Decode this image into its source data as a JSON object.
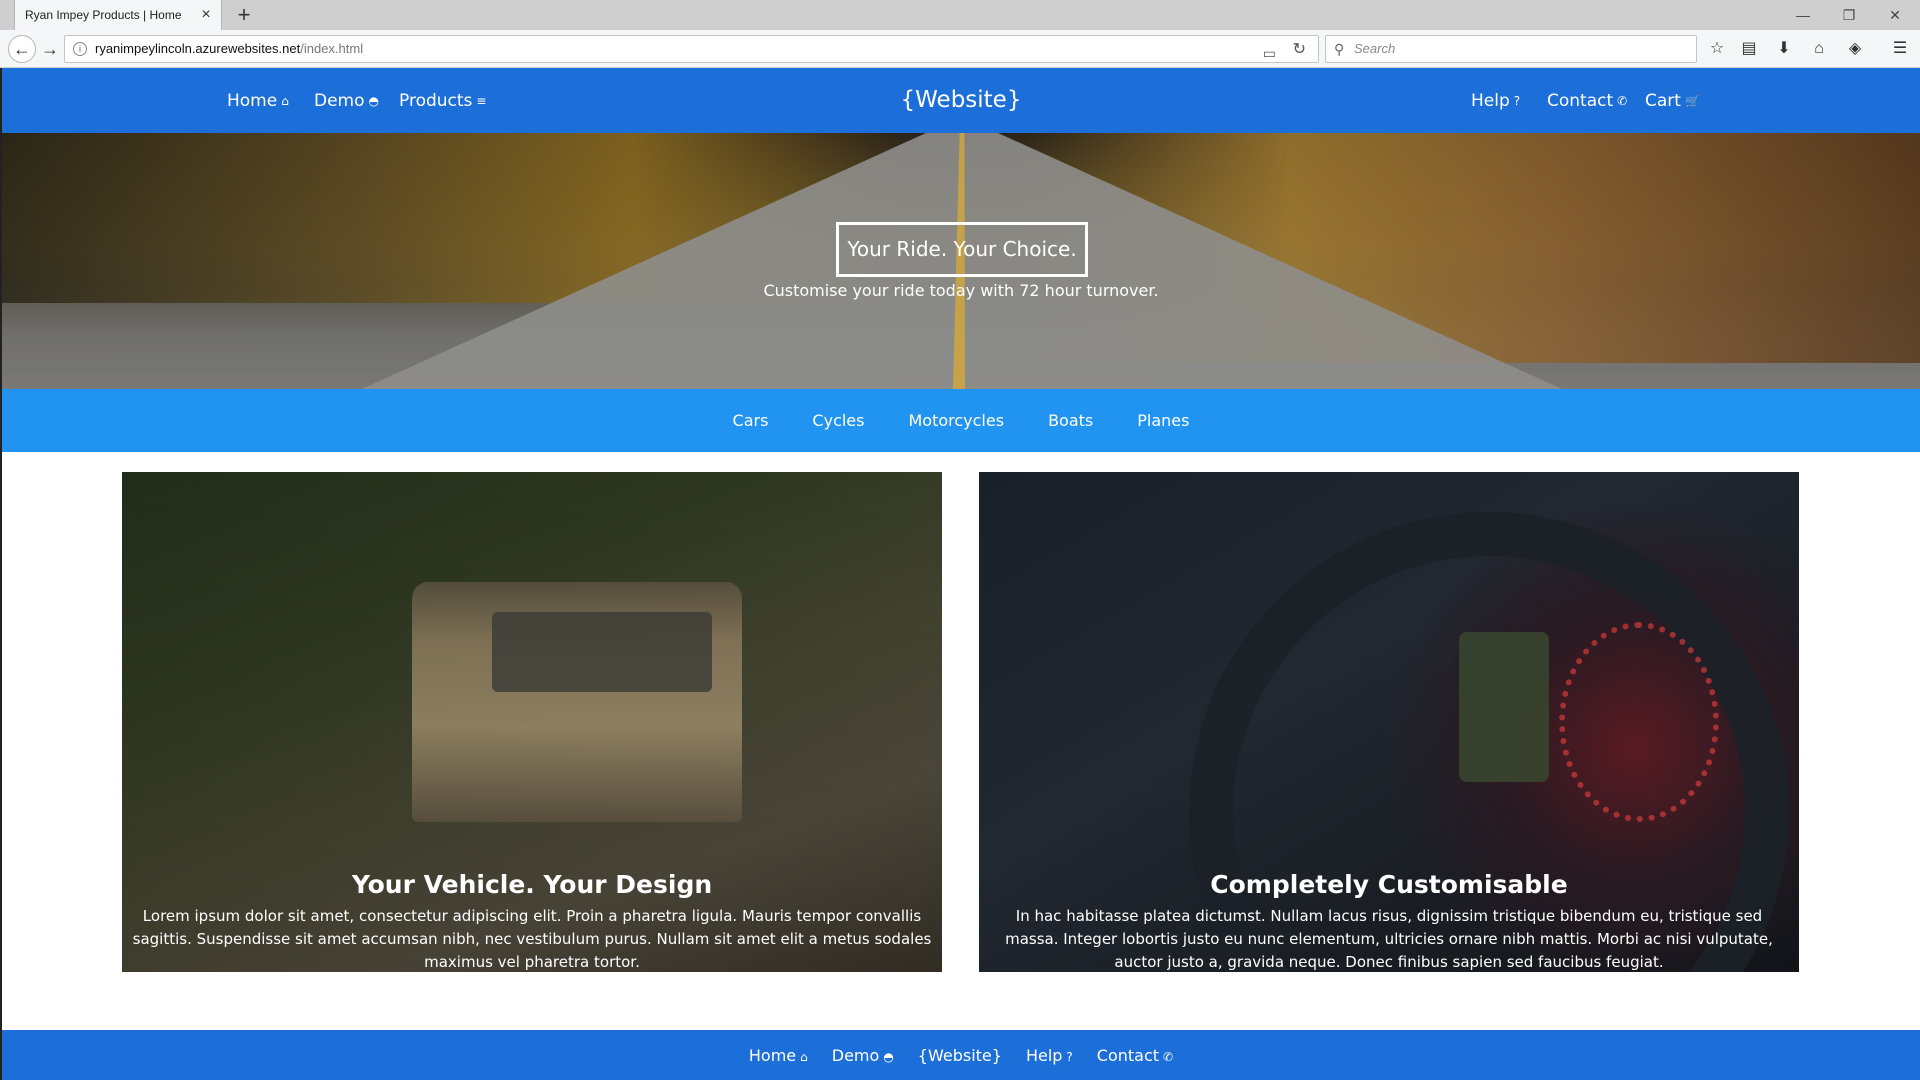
{
  "browser": {
    "tab_title": "Ryan Impey Products | Home",
    "url_host": "ryanimpeylincoln.azurewebsites.net",
    "url_path": "/index.html",
    "search_placeholder": "Search"
  },
  "site": {
    "brand": "{Website}",
    "nav_left": [
      {
        "label": "Home",
        "icon": "home-icon",
        "glyph": "⌂"
      },
      {
        "label": "Demo",
        "icon": "demo-icon",
        "glyph": "◓"
      },
      {
        "label": "Products",
        "icon": "list-icon",
        "glyph": "≡"
      }
    ],
    "nav_right": [
      {
        "label": "Help",
        "icon": "help-icon",
        "glyph": "?"
      },
      {
        "label": "Contact",
        "icon": "phone-icon",
        "glyph": "✆"
      },
      {
        "label": "Cart",
        "icon": "cart-icon",
        "glyph": "🛒"
      }
    ]
  },
  "hero": {
    "title": "Your Ride. Your Choice.",
    "subtitle": "Customise your ride today with 72 hour turnover."
  },
  "categories": [
    "Cars",
    "Cycles",
    "Motorcycles",
    "Boats",
    "Planes"
  ],
  "cards": [
    {
      "title": "Your Vehicle. Your Design",
      "text": "Lorem ipsum dolor sit amet, consectetur adipiscing elit. Proin a pharetra ligula. Mauris tempor convallis sagittis. Suspendisse sit amet accumsan nibh, nec vestibulum purus. Nullam sit amet elit a metus sodales maximus vel pharetra tortor."
    },
    {
      "title": "Completely Customisable",
      "text": "In hac habitasse platea dictumst. Nullam lacus risus, dignissim tristique bibendum eu, tristique sed massa. Integer lobortis justo eu nunc elementum, ultricies ornare nibh mattis. Morbi ac nisi vulputate, auctor justo a, gravida neque. Donec finibus sapien sed faucibus feugiat."
    }
  ],
  "footer": {
    "links": [
      {
        "label": "Home",
        "icon": "home-icon",
        "glyph": "⌂"
      },
      {
        "label": "Demo",
        "icon": "demo-icon",
        "glyph": "◓"
      },
      {
        "label": "{Website}",
        "icon": "",
        "glyph": ""
      },
      {
        "label": "Help",
        "icon": "help-icon",
        "glyph": "?"
      },
      {
        "label": "Contact",
        "icon": "phone-icon",
        "glyph": "✆"
      }
    ]
  },
  "colors": {
    "header": "#1c6fd8",
    "category_bar": "#2193f0"
  }
}
